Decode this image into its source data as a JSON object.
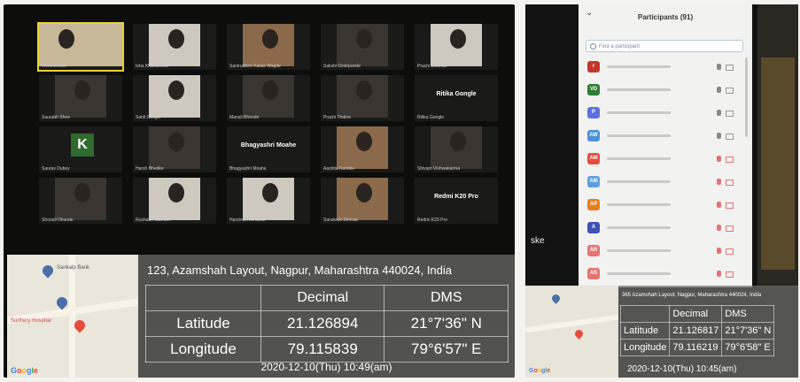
{
  "left": {
    "tiles": [
      {
        "name": "Vivek Dhoke"
      },
      {
        "name": "Isha Khandelwal"
      },
      {
        "name": "Samrudhee Kailas Wagde"
      },
      {
        "name": "Sakshi Deshpande"
      },
      {
        "name": "Prachi Gourkar"
      },
      {
        "name": "Saurabh Shee"
      },
      {
        "name": "Sahil Gongle"
      },
      {
        "name": "Manali Bhende"
      },
      {
        "name": "Prachi Thakre"
      },
      {
        "name": "Ritika Gongle"
      },
      {
        "name": "Saurav Dubey"
      },
      {
        "name": "Harsh Bhedke"
      },
      {
        "name": "Bhagyashri Moahe"
      },
      {
        "name": "Aashita Kamble"
      },
      {
        "name": "Shivam Vishwakarma"
      },
      {
        "name": "Shonali Dhunde"
      },
      {
        "name": "Rushabh Sakhare"
      },
      {
        "name": "Harshita Kolhatkar"
      },
      {
        "name": "Sanskruti Shrivas"
      },
      {
        "name": "Redmi K20 Pro"
      }
    ],
    "avatar_letter": "K",
    "bigname_1": "Bhagyashri Moahe",
    "bigname_2": "Ritika Gongle",
    "bigname_3": "Redmi K20 Pro",
    "map_label": "Sankalp Bank",
    "map_label_2": "Sudhery Hospital",
    "address": "123, Azamshah Layout, Nagpur, Maharashtra 440024, India",
    "hdr_decimal": "Decimal",
    "hdr_dms": "DMS",
    "lat_label": "Latitude",
    "lat_decimal": "21.126894",
    "lat_dms": "21°7'36\" N",
    "lon_label": "Longitude",
    "lon_decimal": "79.115839",
    "lon_dms": "79°6'57\" E",
    "datetime": "2020-12-10(Thu)  10:49(am)"
  },
  "right": {
    "side_text": "ske",
    "panel_title": "Participants (91)",
    "find_placeholder": "Find a participant",
    "participants": [
      {
        "initials": "r",
        "color": "#c0392b"
      },
      {
        "initials": "VD",
        "color": "#2e7d32"
      },
      {
        "initials": "P",
        "color": "#5b6fe0"
      },
      {
        "initials": "AW",
        "color": "#4a90d9"
      },
      {
        "initials": "AM",
        "color": "#e74c3c"
      },
      {
        "initials": "AM",
        "color": "#5aa0e0"
      },
      {
        "initials": "AP",
        "color": "#e67e22"
      },
      {
        "initials": "A",
        "color": "#3f51b5"
      },
      {
        "initials": "AR",
        "color": "#e57373"
      },
      {
        "initials": "AS",
        "color": "#e57373"
      }
    ],
    "address": "365 Azamshah Layout, Nagpur, Maharashtra 440024, India",
    "hdr_decimal": "Decimal",
    "hdr_dms": "DMS",
    "lat_label": "Latitude",
    "lat_decimal": "21.126817",
    "lat_dms": "21°7'36\" N",
    "lon_label": "Longitude",
    "lon_decimal": "79.116219",
    "lon_dms": "79°6'58\" E",
    "datetime": "2020-12-10(Thu)  10:45(am)"
  },
  "google": {
    "g": "G",
    "o1": "o",
    "o2": "o",
    "g2": "g",
    "l": "l",
    "e": "e"
  }
}
